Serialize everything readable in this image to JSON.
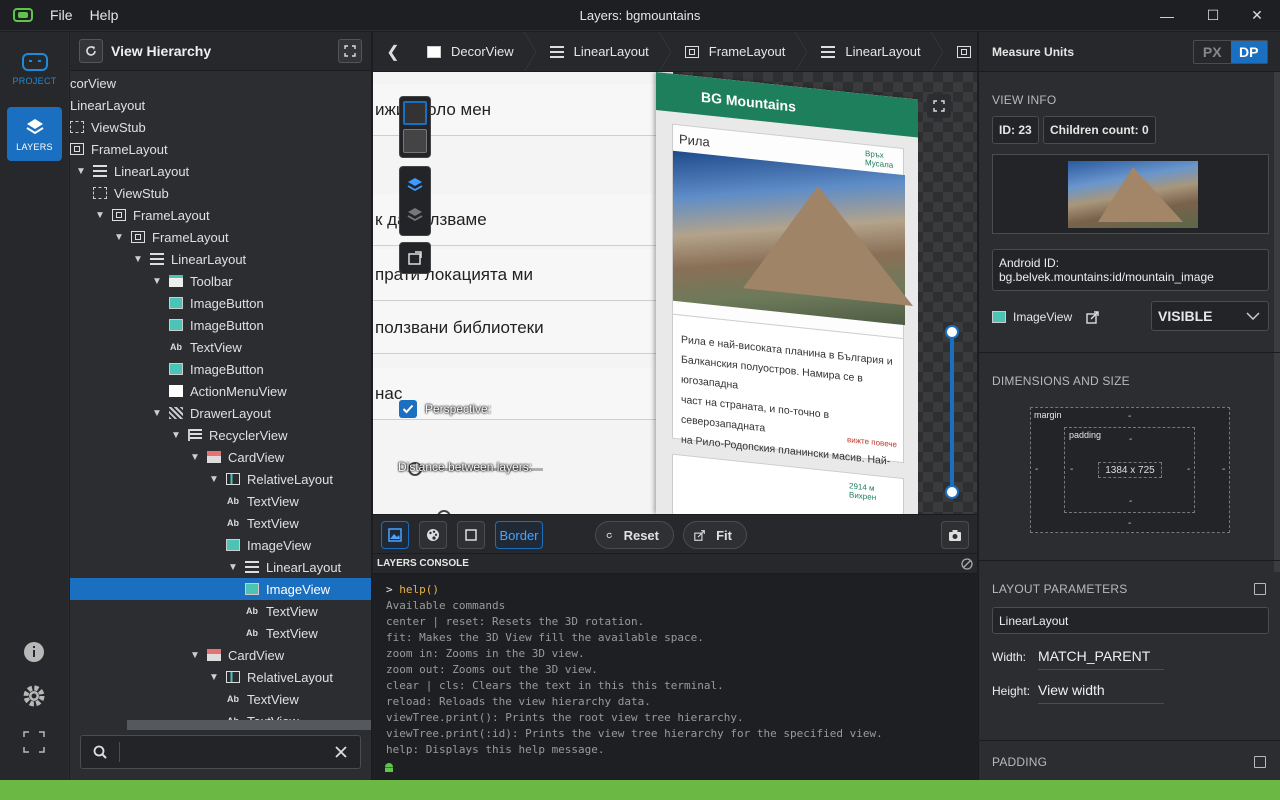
{
  "window": {
    "title": "Layers: bgmountains",
    "menu": [
      "File",
      "Help"
    ],
    "controls": [
      "—",
      "☐",
      "✕"
    ]
  },
  "nav": {
    "project_label": "PROJECT",
    "layers_label": "LAYERS"
  },
  "tree": {
    "title": "View Hierarchy",
    "search_placeholder": "",
    "rows": [
      {
        "label": "corView",
        "icon": "none",
        "toggle": "",
        "depth": 0
      },
      {
        "label": "LinearLayout",
        "icon": "none",
        "toggle": "",
        "depth": 0
      },
      {
        "label": "ViewStub",
        "icon": "stub",
        "toggle": "",
        "depth": 0
      },
      {
        "label": "FrameLayout",
        "icon": "frame",
        "toggle": "",
        "depth": 0
      },
      {
        "label": "LinearLayout",
        "icon": "ll",
        "toggle": "▼",
        "depth": 0
      },
      {
        "label": "ViewStub",
        "icon": "stub",
        "toggle": "",
        "depth": 1
      },
      {
        "label": "FrameLayout",
        "icon": "frame",
        "toggle": "▼",
        "depth": 1
      },
      {
        "label": "FrameLayout",
        "icon": "frame",
        "toggle": "▼",
        "depth": 2
      },
      {
        "label": "LinearLayout",
        "icon": "ll",
        "toggle": "▼",
        "depth": 3
      },
      {
        "label": "Toolbar",
        "icon": "tool",
        "toggle": "▼",
        "depth": 4
      },
      {
        "label": "ImageButton",
        "icon": "img",
        "toggle": "",
        "depth": 5
      },
      {
        "label": "ImageButton",
        "icon": "img",
        "toggle": "",
        "depth": 5
      },
      {
        "label": "TextView",
        "icon": "text",
        "toggle": "",
        "depth": 5
      },
      {
        "label": "ImageButton",
        "icon": "img",
        "toggle": "",
        "depth": 5
      },
      {
        "label": "ActionMenuView",
        "icon": "menu",
        "toggle": "",
        "depth": 5
      },
      {
        "label": "DrawerLayout",
        "icon": "drawer",
        "toggle": "▼",
        "depth": 4
      },
      {
        "label": "RecyclerView",
        "icon": "rv",
        "toggle": "▼",
        "depth": 5
      },
      {
        "label": "CardView",
        "icon": "card",
        "toggle": "▼",
        "depth": 6
      },
      {
        "label": "RelativeLayout",
        "icon": "rel",
        "toggle": "▼",
        "depth": 7
      },
      {
        "label": "TextView",
        "icon": "text",
        "toggle": "",
        "depth": 8
      },
      {
        "label": "TextView",
        "icon": "text",
        "toggle": "",
        "depth": 8
      },
      {
        "label": "ImageView",
        "icon": "img",
        "toggle": "",
        "depth": 8
      },
      {
        "label": "LinearLayout",
        "icon": "ll",
        "toggle": "▼",
        "depth": 8
      },
      {
        "label": "ImageView",
        "icon": "img",
        "toggle": "",
        "depth": 9,
        "selected": true
      },
      {
        "label": "TextView",
        "icon": "text",
        "toggle": "",
        "depth": 9
      },
      {
        "label": "TextView",
        "icon": "text",
        "toggle": "",
        "depth": 9
      },
      {
        "label": "CardView",
        "icon": "card",
        "toggle": "▼",
        "depth": 6
      },
      {
        "label": "RelativeLayout",
        "icon": "rel",
        "toggle": "▼",
        "depth": 7
      },
      {
        "label": "TextView",
        "icon": "text",
        "toggle": "",
        "depth": 8
      },
      {
        "label": "TextView",
        "icon": "text",
        "toggle": "",
        "depth": 8
      }
    ]
  },
  "breadcrumbs": [
    "DecorView",
    "LinearLayout",
    "FrameLayout",
    "LinearLayout",
    "Fr"
  ],
  "stage": {
    "menu_rows": [
      "ижи около мен",
      "к да ползваме",
      "прати локацията ми",
      "ползвани библиотеки",
      "нас"
    ],
    "phone_title": "BG Mountains",
    "phone_label": "Рила",
    "phone_desc": [
      "Рила е най-високата планина в България и",
      "Балканския полуостров. Намира се в югозападна",
      "част на страната, и по-точно в северозападната",
      "на Рило-Родопския планински масив. Най-висок"
    ],
    "side_text_1": "Връх Мусала",
    "side_text_2": "вижте повече",
    "side_text_3": "2914 м Вихрен",
    "perspective_label": "Perspective:",
    "perspective_value": 0,
    "distance_label": "Distance between layers:",
    "distance_value": 0.24,
    "zoom_value": 1
  },
  "toolbar": {
    "border_label": "Border",
    "reset_label": "Reset",
    "fit_label": "Fit"
  },
  "console": {
    "title": "LAYERS CONSOLE",
    "prompt": ">",
    "command": "help()",
    "lines": [
      "Available commands",
      "center | reset: Resets the 3D rotation.",
      "fit: Makes the 3D View fill the available space.",
      "zoom in: Zooms in the 3D view.",
      "zoom out: Zooms out the 3D view.",
      "clear | cls: Clears the text in this this terminal.",
      "reload: Reloads the view hierarchy data.",
      "viewTree.print(): Prints the root view tree hierarchy.",
      "viewTree.print(:id): Prints the view tree hierarchy for the specified view.",
      "help: Displays this help message."
    ]
  },
  "props": {
    "title": "Measure Units",
    "unit_px": "PX",
    "unit_dp": "DP",
    "view_info_title": "VIEW INFO",
    "id_chip": "ID: 23",
    "children_chip": "Children count: 0",
    "android_id_label": "Android ID:",
    "android_id_value": "bg.belvek.mountains:id/mountain_image",
    "class_name": "ImageView",
    "visibility": "VISIBLE",
    "dimensions_title": "DIMENSIONS AND SIZE",
    "margin_label": "margin",
    "padding_label": "padding",
    "size_value": "1384 x 725",
    "dash": "-",
    "layout_params_title": "LAYOUT PARAMETERS",
    "layout_class": "LinearLayout",
    "width_label": "Width:",
    "width_value": "MATCH_PARENT",
    "height_label": "Height:",
    "height_value": "View width",
    "padding_title": "PADDING"
  },
  "colors": {
    "accent": "#1a6fc0",
    "status_bar": "#6cb845",
    "toolbar_green": "#1e7f5c"
  }
}
